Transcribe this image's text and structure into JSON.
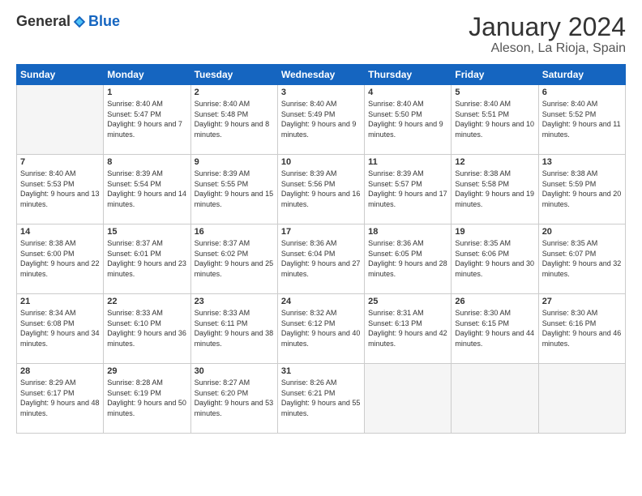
{
  "header": {
    "logo_general": "General",
    "logo_blue": "Blue",
    "month_title": "January 2024",
    "location": "Aleson, La Rioja, Spain"
  },
  "days_of_week": [
    "Sunday",
    "Monday",
    "Tuesday",
    "Wednesday",
    "Thursday",
    "Friday",
    "Saturday"
  ],
  "weeks": [
    [
      {
        "day": "",
        "sunrise": "",
        "sunset": "",
        "daylight": "",
        "empty": true
      },
      {
        "day": "1",
        "sunrise": "Sunrise: 8:40 AM",
        "sunset": "Sunset: 5:47 PM",
        "daylight": "Daylight: 9 hours and 7 minutes."
      },
      {
        "day": "2",
        "sunrise": "Sunrise: 8:40 AM",
        "sunset": "Sunset: 5:48 PM",
        "daylight": "Daylight: 9 hours and 8 minutes."
      },
      {
        "day": "3",
        "sunrise": "Sunrise: 8:40 AM",
        "sunset": "Sunset: 5:49 PM",
        "daylight": "Daylight: 9 hours and 9 minutes."
      },
      {
        "day": "4",
        "sunrise": "Sunrise: 8:40 AM",
        "sunset": "Sunset: 5:50 PM",
        "daylight": "Daylight: 9 hours and 9 minutes."
      },
      {
        "day": "5",
        "sunrise": "Sunrise: 8:40 AM",
        "sunset": "Sunset: 5:51 PM",
        "daylight": "Daylight: 9 hours and 10 minutes."
      },
      {
        "day": "6",
        "sunrise": "Sunrise: 8:40 AM",
        "sunset": "Sunset: 5:52 PM",
        "daylight": "Daylight: 9 hours and 11 minutes."
      }
    ],
    [
      {
        "day": "7",
        "sunrise": "Sunrise: 8:40 AM",
        "sunset": "Sunset: 5:53 PM",
        "daylight": "Daylight: 9 hours and 13 minutes."
      },
      {
        "day": "8",
        "sunrise": "Sunrise: 8:39 AM",
        "sunset": "Sunset: 5:54 PM",
        "daylight": "Daylight: 9 hours and 14 minutes."
      },
      {
        "day": "9",
        "sunrise": "Sunrise: 8:39 AM",
        "sunset": "Sunset: 5:55 PM",
        "daylight": "Daylight: 9 hours and 15 minutes."
      },
      {
        "day": "10",
        "sunrise": "Sunrise: 8:39 AM",
        "sunset": "Sunset: 5:56 PM",
        "daylight": "Daylight: 9 hours and 16 minutes."
      },
      {
        "day": "11",
        "sunrise": "Sunrise: 8:39 AM",
        "sunset": "Sunset: 5:57 PM",
        "daylight": "Daylight: 9 hours and 17 minutes."
      },
      {
        "day": "12",
        "sunrise": "Sunrise: 8:38 AM",
        "sunset": "Sunset: 5:58 PM",
        "daylight": "Daylight: 9 hours and 19 minutes."
      },
      {
        "day": "13",
        "sunrise": "Sunrise: 8:38 AM",
        "sunset": "Sunset: 5:59 PM",
        "daylight": "Daylight: 9 hours and 20 minutes."
      }
    ],
    [
      {
        "day": "14",
        "sunrise": "Sunrise: 8:38 AM",
        "sunset": "Sunset: 6:00 PM",
        "daylight": "Daylight: 9 hours and 22 minutes."
      },
      {
        "day": "15",
        "sunrise": "Sunrise: 8:37 AM",
        "sunset": "Sunset: 6:01 PM",
        "daylight": "Daylight: 9 hours and 23 minutes."
      },
      {
        "day": "16",
        "sunrise": "Sunrise: 8:37 AM",
        "sunset": "Sunset: 6:02 PM",
        "daylight": "Daylight: 9 hours and 25 minutes."
      },
      {
        "day": "17",
        "sunrise": "Sunrise: 8:36 AM",
        "sunset": "Sunset: 6:04 PM",
        "daylight": "Daylight: 9 hours and 27 minutes."
      },
      {
        "day": "18",
        "sunrise": "Sunrise: 8:36 AM",
        "sunset": "Sunset: 6:05 PM",
        "daylight": "Daylight: 9 hours and 28 minutes."
      },
      {
        "day": "19",
        "sunrise": "Sunrise: 8:35 AM",
        "sunset": "Sunset: 6:06 PM",
        "daylight": "Daylight: 9 hours and 30 minutes."
      },
      {
        "day": "20",
        "sunrise": "Sunrise: 8:35 AM",
        "sunset": "Sunset: 6:07 PM",
        "daylight": "Daylight: 9 hours and 32 minutes."
      }
    ],
    [
      {
        "day": "21",
        "sunrise": "Sunrise: 8:34 AM",
        "sunset": "Sunset: 6:08 PM",
        "daylight": "Daylight: 9 hours and 34 minutes."
      },
      {
        "day": "22",
        "sunrise": "Sunrise: 8:33 AM",
        "sunset": "Sunset: 6:10 PM",
        "daylight": "Daylight: 9 hours and 36 minutes."
      },
      {
        "day": "23",
        "sunrise": "Sunrise: 8:33 AM",
        "sunset": "Sunset: 6:11 PM",
        "daylight": "Daylight: 9 hours and 38 minutes."
      },
      {
        "day": "24",
        "sunrise": "Sunrise: 8:32 AM",
        "sunset": "Sunset: 6:12 PM",
        "daylight": "Daylight: 9 hours and 40 minutes."
      },
      {
        "day": "25",
        "sunrise": "Sunrise: 8:31 AM",
        "sunset": "Sunset: 6:13 PM",
        "daylight": "Daylight: 9 hours and 42 minutes."
      },
      {
        "day": "26",
        "sunrise": "Sunrise: 8:30 AM",
        "sunset": "Sunset: 6:15 PM",
        "daylight": "Daylight: 9 hours and 44 minutes."
      },
      {
        "day": "27",
        "sunrise": "Sunrise: 8:30 AM",
        "sunset": "Sunset: 6:16 PM",
        "daylight": "Daylight: 9 hours and 46 minutes."
      }
    ],
    [
      {
        "day": "28",
        "sunrise": "Sunrise: 8:29 AM",
        "sunset": "Sunset: 6:17 PM",
        "daylight": "Daylight: 9 hours and 48 minutes."
      },
      {
        "day": "29",
        "sunrise": "Sunrise: 8:28 AM",
        "sunset": "Sunset: 6:19 PM",
        "daylight": "Daylight: 9 hours and 50 minutes."
      },
      {
        "day": "30",
        "sunrise": "Sunrise: 8:27 AM",
        "sunset": "Sunset: 6:20 PM",
        "daylight": "Daylight: 9 hours and 53 minutes."
      },
      {
        "day": "31",
        "sunrise": "Sunrise: 8:26 AM",
        "sunset": "Sunset: 6:21 PM",
        "daylight": "Daylight: 9 hours and 55 minutes."
      },
      {
        "day": "",
        "sunrise": "",
        "sunset": "",
        "daylight": "",
        "empty": true
      },
      {
        "day": "",
        "sunrise": "",
        "sunset": "",
        "daylight": "",
        "empty": true
      },
      {
        "day": "",
        "sunrise": "",
        "sunset": "",
        "daylight": "",
        "empty": true
      }
    ]
  ]
}
